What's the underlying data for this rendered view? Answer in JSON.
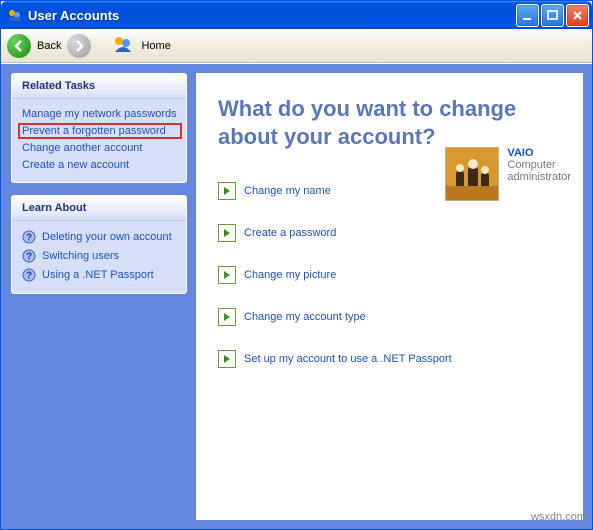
{
  "window": {
    "title": "User Accounts"
  },
  "toolbar": {
    "back": "Back",
    "home": "Home"
  },
  "sidebar": {
    "related_header": "Related Tasks",
    "related": [
      "Manage my network passwords",
      "Prevent a forgotten password",
      "Change another account",
      "Create a new account"
    ],
    "learn_header": "Learn About",
    "learn": [
      "Deleting your own account",
      "Switching users",
      "Using a .NET Passport"
    ]
  },
  "main": {
    "heading": "What do you want to change about your account?",
    "actions": [
      "Change my name",
      "Create a password",
      "Change my picture",
      "Change my account type",
      "Set up my account to use a .NET Passport"
    ],
    "user": {
      "name": "VAIO",
      "role1": "Computer",
      "role2": "administrator"
    }
  },
  "watermark": "wsxdn.com"
}
